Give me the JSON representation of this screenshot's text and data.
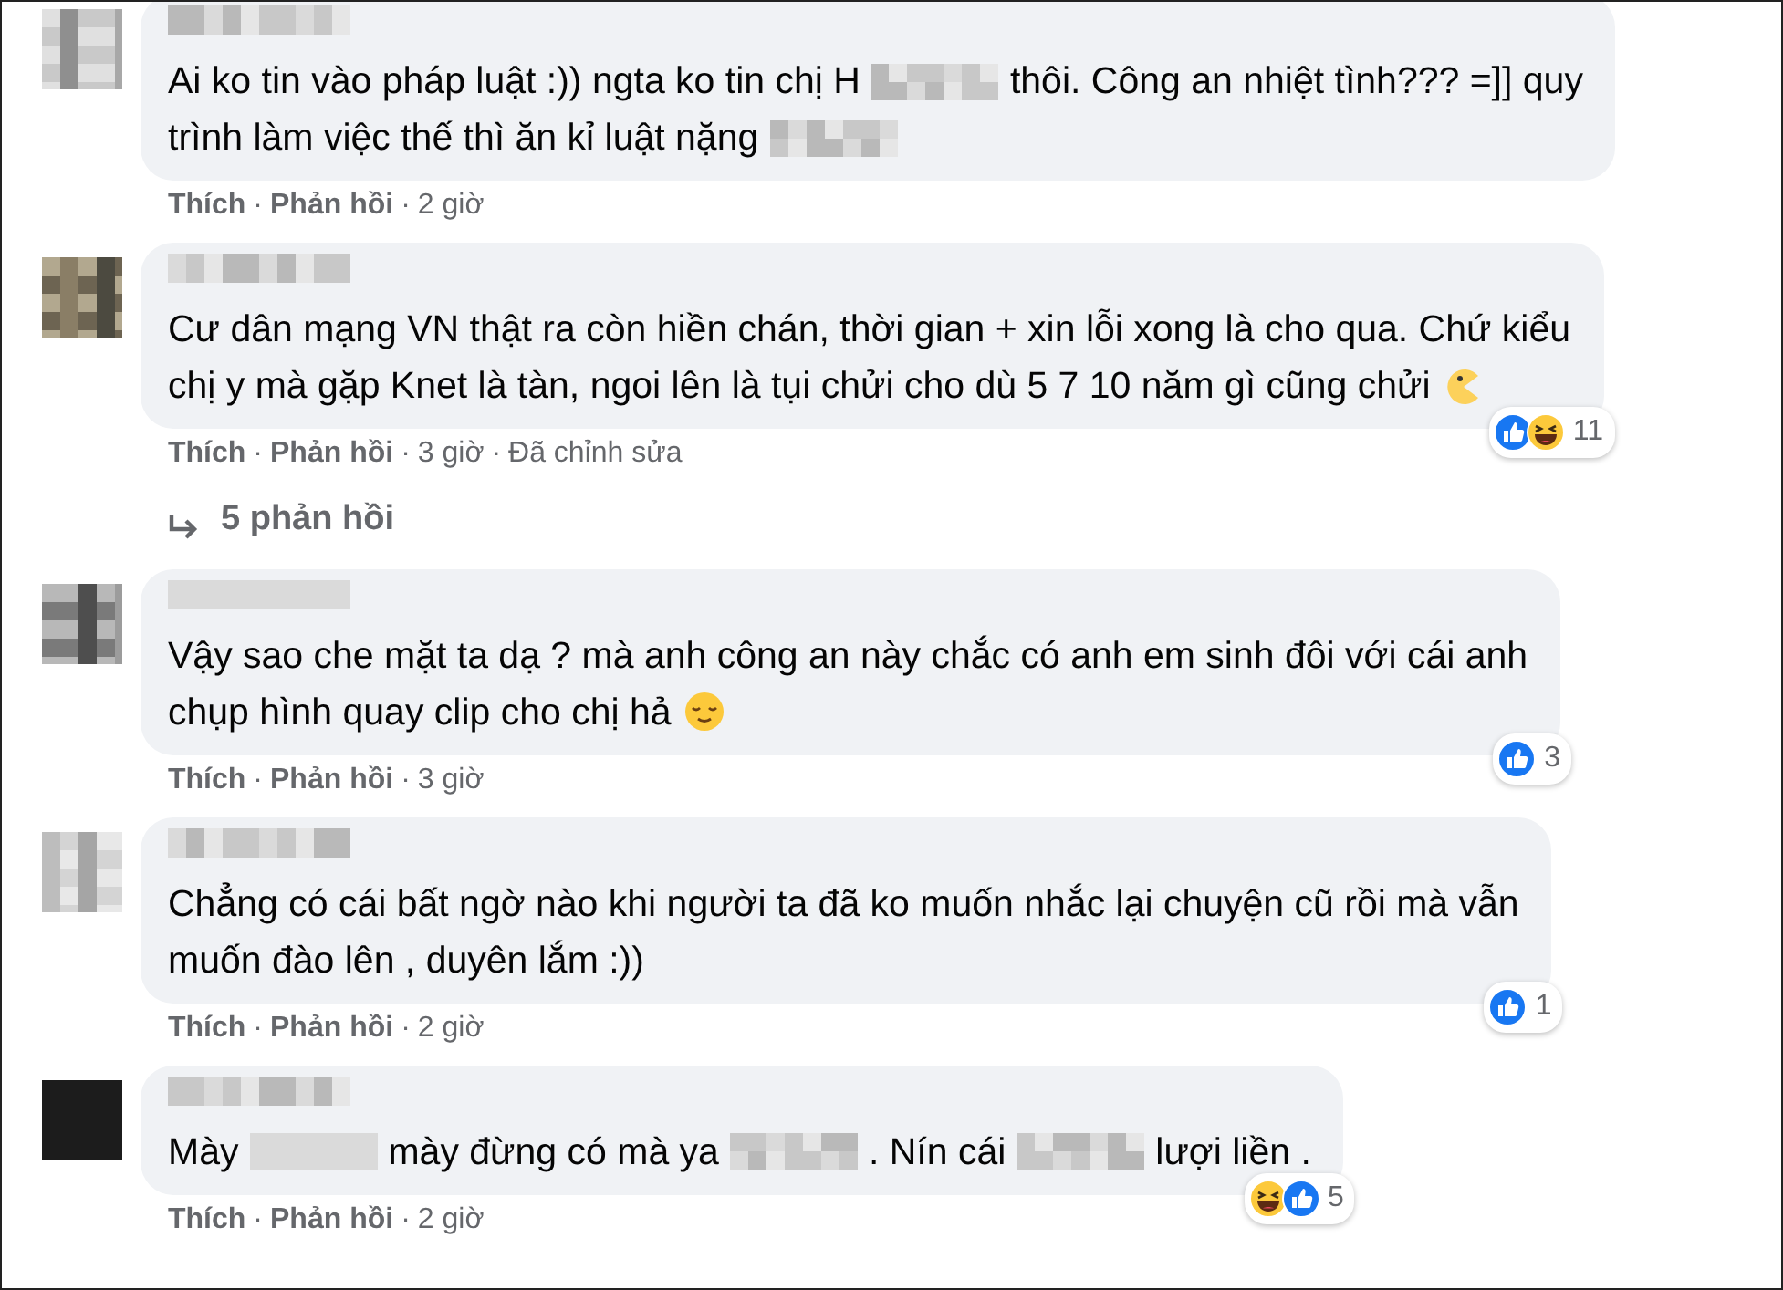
{
  "comments": [
    {
      "lines": [
        [
          {
            "kind": "text",
            "value": "Ai ko tin vào pháp luật :)) ngta ko tin chị H"
          },
          {
            "kind": "blur"
          },
          {
            "kind": "text",
            "value": "thôi. Công an nhiệt tình??? =]] quy"
          }
        ],
        [
          {
            "kind": "text",
            "value": "trình làm việc thế thì ăn kỉ luật nặng"
          },
          {
            "kind": "blur"
          }
        ]
      ],
      "actions": {
        "like": "Thích",
        "reply": "Phản hồi",
        "time": "2 giờ",
        "separator": "·"
      }
    },
    {
      "lines": [
        [
          {
            "kind": "text",
            "value": "Cư dân mạng VN thật ra còn hiền chán, thời gian + xin lỗi xong là cho qua. Chứ kiểu"
          }
        ],
        [
          {
            "kind": "text",
            "value": "chị y mà gặp Knet là tàn, ngoi lên là tụi chửi cho dù 5 7 10 năm gì cũng chửi"
          },
          {
            "kind": "pacman"
          }
        ]
      ],
      "actions": {
        "like": "Thích",
        "reply": "Phản hồi",
        "time": "3 giờ",
        "edited": "Đã chỉnh sửa",
        "separator": "·"
      },
      "reactions": {
        "icons": [
          {
            "kind": "like"
          },
          {
            "kind": "haha"
          }
        ],
        "count": "11"
      },
      "replies": "5 phản hồi"
    },
    {
      "lines": [
        [
          {
            "kind": "text",
            "value": "Vậy sao che mặt ta dạ ? mà anh công an này chắc có anh em sinh đôi với cái anh"
          }
        ],
        [
          {
            "kind": "text",
            "value": "chụp hình quay clip cho chị hả"
          },
          {
            "kind": "smile"
          }
        ]
      ],
      "actions": {
        "like": "Thích",
        "reply": "Phản hồi",
        "time": "3 giờ",
        "separator": "·"
      },
      "reactions": {
        "icons": [
          {
            "kind": "like"
          }
        ],
        "count": "3"
      }
    },
    {
      "lines": [
        [
          {
            "kind": "text",
            "value": "Chẳng có cái bất ngờ nào khi người ta đã ko muốn nhắc lại chuyện cũ rồi mà vẫn"
          }
        ],
        [
          {
            "kind": "text",
            "value": "muốn đào lên , duyên lắm :))"
          }
        ]
      ],
      "actions": {
        "like": "Thích",
        "reply": "Phản hồi",
        "time": "2 giờ",
        "separator": "·"
      },
      "reactions": {
        "icons": [
          {
            "kind": "like"
          }
        ],
        "count": "1"
      }
    },
    {
      "lines": [
        [
          {
            "kind": "text",
            "value": "Mày"
          },
          {
            "kind": "blur"
          },
          {
            "kind": "text",
            "value": "mày đừng có mà ya"
          },
          {
            "kind": "blur"
          },
          {
            "kind": "text",
            "value": ". Nín cái"
          },
          {
            "kind": "blur"
          },
          {
            "kind": "text",
            "value": "lượi liền ."
          }
        ]
      ],
      "actions": {
        "like": "Thích",
        "reply": "Phản hồi",
        "time": "2 giờ",
        "separator": "·"
      },
      "reactions": {
        "icons": [
          {
            "kind": "haha"
          },
          {
            "kind": "like"
          }
        ],
        "count": "5"
      }
    }
  ]
}
